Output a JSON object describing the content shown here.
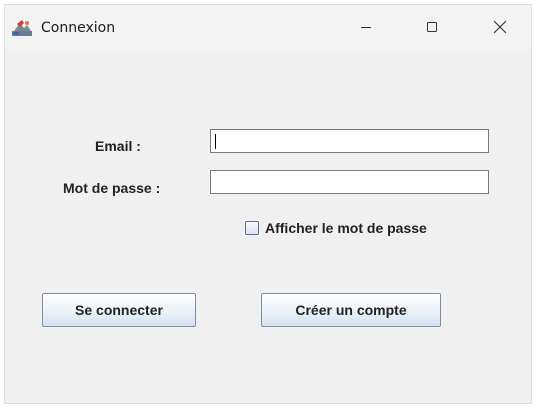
{
  "window": {
    "title": "Connexion",
    "icon": "java-app-icon",
    "controls": [
      "minimize-icon",
      "maximize-icon",
      "close-icon"
    ]
  },
  "form": {
    "email_label": "Email :",
    "email_value": "",
    "password_label": "Mot de passe :",
    "password_value": "",
    "show_password_label": "Afficher le mot de passe",
    "show_password_checked": false
  },
  "actions": {
    "connect_label": "Se connecter",
    "create_label": "Créer un compte"
  }
}
